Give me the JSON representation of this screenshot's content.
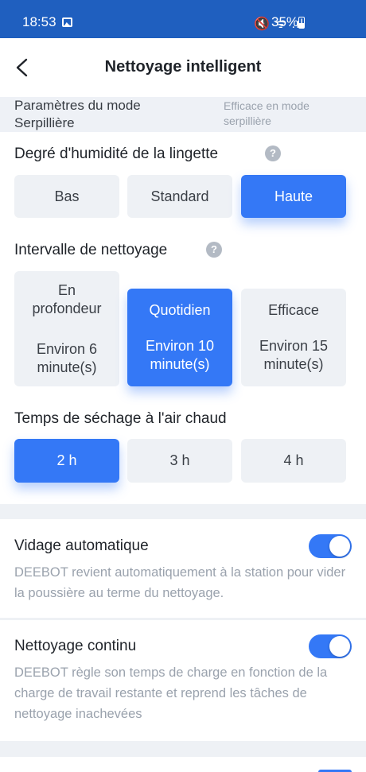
{
  "status_bar": {
    "time": "18:53",
    "icons": [
      "gallery-icon",
      "mute-icon",
      "wifi-icon",
      "signal-icon"
    ],
    "right_icons_text": "🔇 ᯤ .ıl",
    "battery": "35%"
  },
  "header": {
    "back_icon": "chevron-left-icon",
    "title": "Nettoyage intelligent"
  },
  "mode_banner": {
    "label": "Paramètres du mode Serpillière",
    "value": "Efficace en mode serpillière"
  },
  "wetness": {
    "title": "Degré d'humidité de la lingette",
    "help": "?",
    "options": [
      "Bas",
      "Standard",
      "Haute"
    ],
    "selected": "Haute"
  },
  "interval": {
    "title": "Intervalle de nettoyage",
    "help": "?",
    "options": [
      {
        "name": "En profondeur",
        "duration": "Environ 6 minute(s)"
      },
      {
        "name": "Quotidien",
        "duration": "Environ 10 minute(s)"
      },
      {
        "name": "Efficace",
        "duration": "Environ 15 minute(s)"
      }
    ],
    "selected": "Quotidien"
  },
  "drying": {
    "title": "Temps de séchage à l'air chaud",
    "options": [
      "2 h",
      "3 h",
      "4 h"
    ],
    "selected": "2 h"
  },
  "auto_empty": {
    "title": "Vidage automatique",
    "description": "DEEBOT revient automatiquement à la station pour vider la poussière au terme du nettoyage.",
    "enabled": true
  },
  "continuous": {
    "title": "Nettoyage continu",
    "description": "DEEBOT règle son temps de charge en fonction de la charge de travail restante et reprend les tâches de nettoyage inachevées",
    "enabled": true
  },
  "colors": {
    "accent": "#3478f6",
    "status_bar": "#1f5fbf",
    "muted_text": "#9aa2ad"
  }
}
